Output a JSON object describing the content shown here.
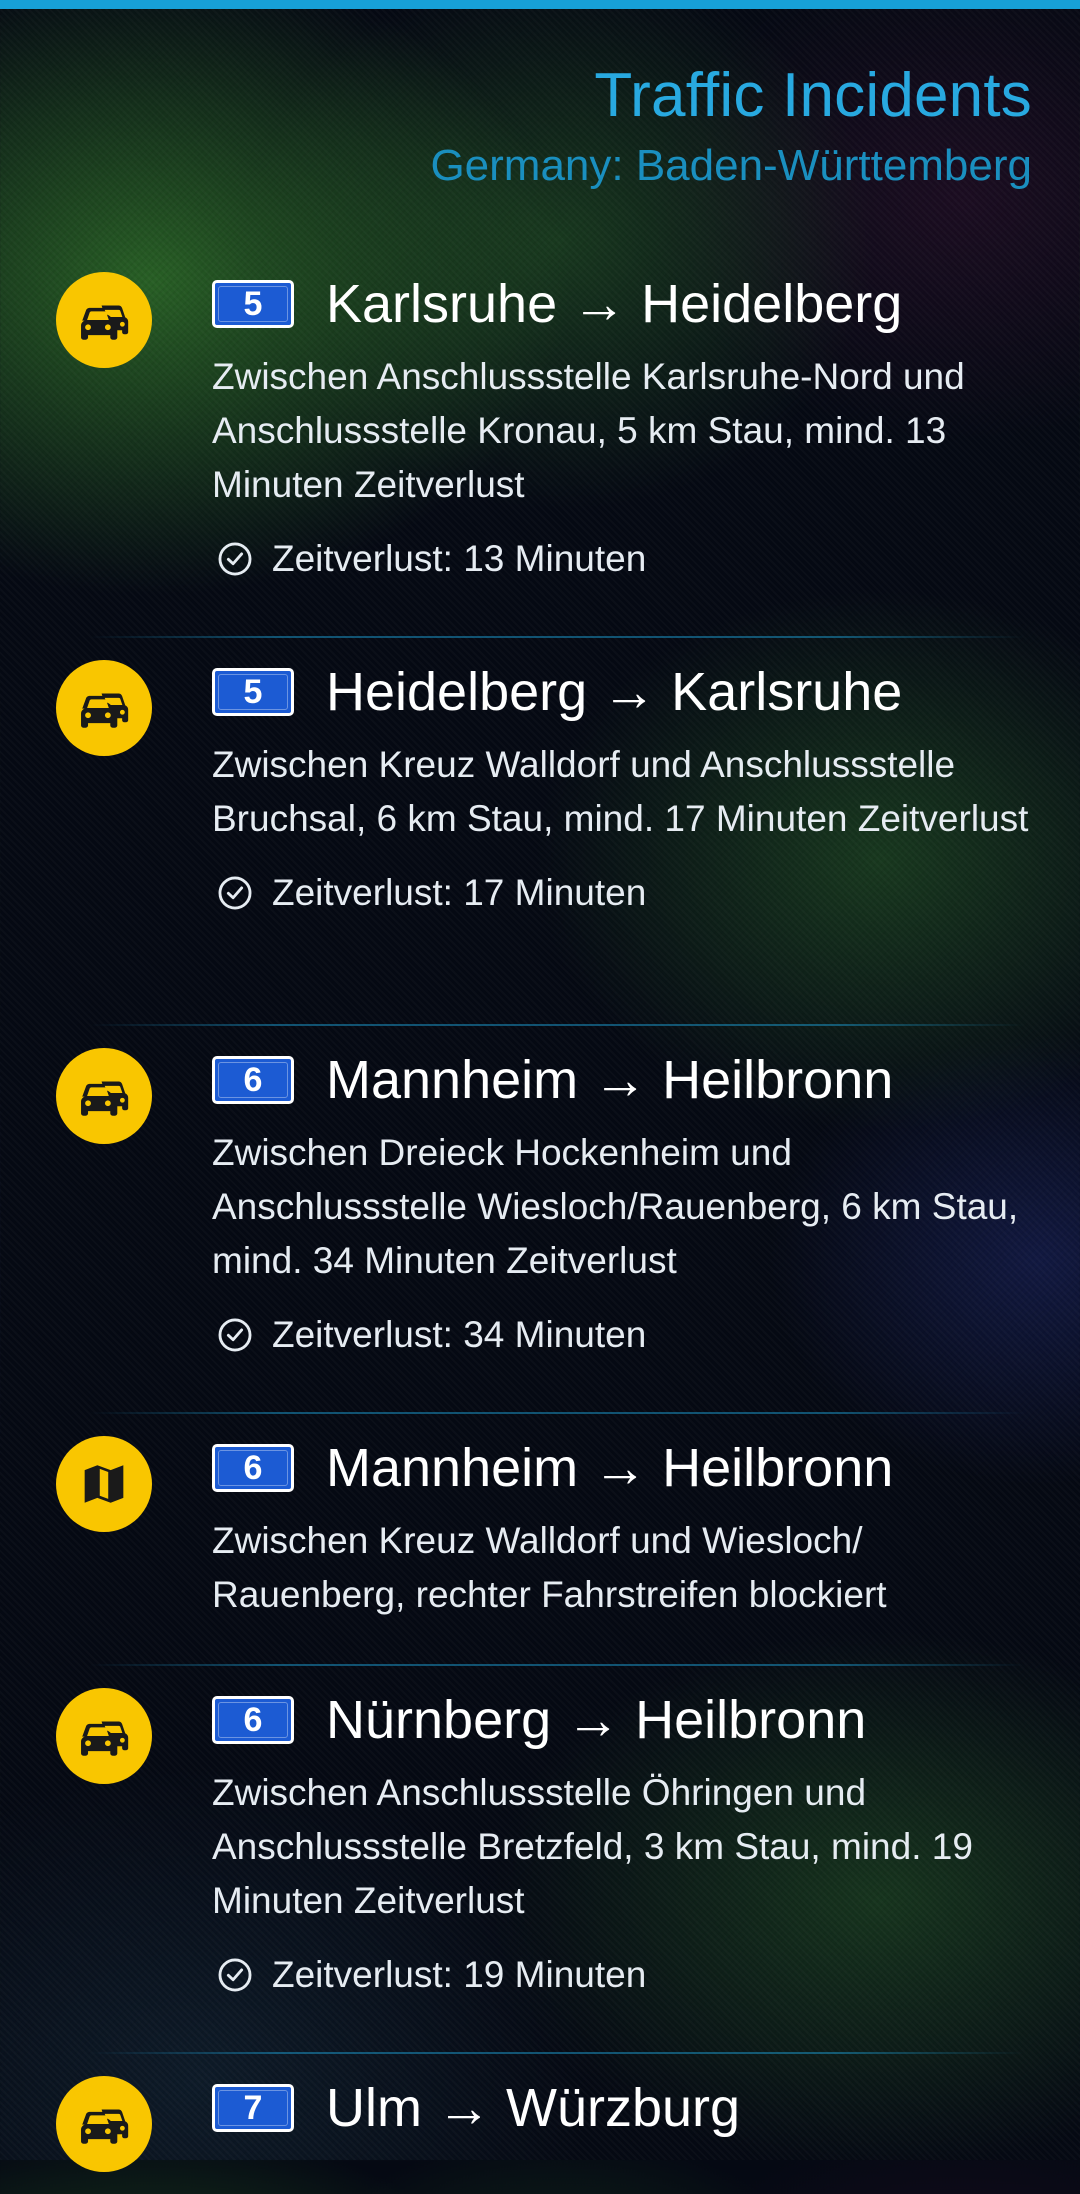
{
  "header": {
    "title": "Traffic Incidents",
    "subtitle": "Germany: Baden-Württemberg"
  },
  "colors": {
    "accent": "#28a9e0",
    "subtitle": "#1a8fbf",
    "badge": "#f9c600",
    "shield": "#1c5bd3"
  },
  "incidents": [
    {
      "icon": "traffic-jam-icon",
      "road": "5",
      "route": "Karlsruhe → Heidelberg",
      "description": "Zwischen Anschlussstelle Karlsruhe-Nord und Anschlussstelle Kronau, 5 km Stau, mind. 13 Minuten Zeitverlust",
      "delay": "Zeitverlust: 13 Minuten"
    },
    {
      "icon": "traffic-jam-icon",
      "road": "5",
      "route": "Heidelberg → Karlsruhe",
      "description": "Zwischen Kreuz Walldorf und Anschlussstelle Bruchsal, 6 km Stau, mind. 17 Minuten Zeitverlust",
      "delay": "Zeitverlust: 17 Minuten"
    },
    {
      "icon": "traffic-jam-icon",
      "road": "6",
      "route": "Mannheim → Heilbronn",
      "description": "Zwischen Dreieck Hockenheim und Anschlussstelle Wiesloch/Rauenberg, 6 km Stau, mind. 34 Minuten Zeitverlust",
      "delay": "Zeitverlust: 34 Minuten"
    },
    {
      "icon": "map-icon",
      "road": "6",
      "route": "Mannheim → Heilbronn",
      "description": "Zwischen Kreuz Walldorf und Wiesloch/ Rauenberg, rechter Fahrstreifen blockiert",
      "delay": ""
    },
    {
      "icon": "traffic-jam-icon",
      "road": "6",
      "route": "Nürnberg → Heilbronn",
      "description": "Zwischen Anschlussstelle Öhringen und Anschlussstelle Bretzfeld, 3 km Stau, mind. 19 Minuten Zeitverlust",
      "delay": "Zeitverlust: 19 Minuten"
    },
    {
      "icon": "traffic-jam-icon",
      "road": "7",
      "route": "Ulm → Würzburg",
      "description": "",
      "delay": ""
    }
  ]
}
